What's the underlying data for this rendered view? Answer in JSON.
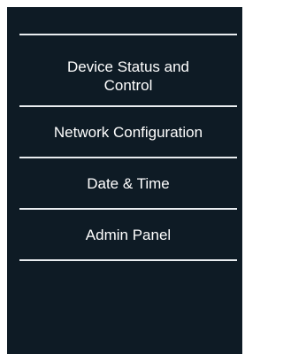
{
  "nav": {
    "items": [
      {
        "label_line1": "Device Status and",
        "label_line2": "Control"
      },
      {
        "label": "Network Configuration"
      },
      {
        "label": "Date & Time"
      },
      {
        "label": "Admin Panel"
      }
    ]
  }
}
